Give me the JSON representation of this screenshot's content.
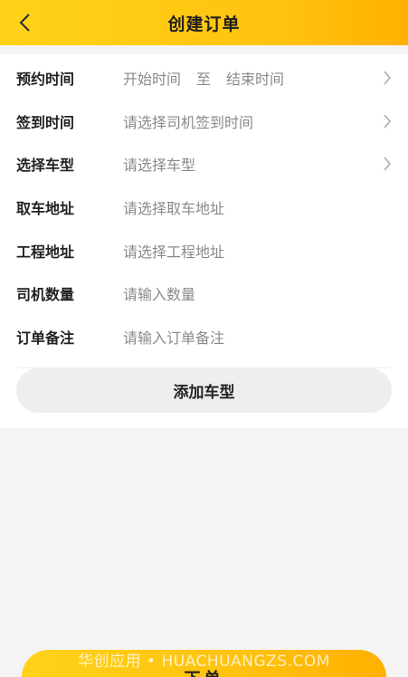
{
  "header": {
    "title": "创建订单",
    "back_icon": "chevron-left-icon"
  },
  "form": {
    "rows": [
      {
        "label": "预约时间",
        "start_placeholder": "开始时间",
        "separator": "至",
        "end_placeholder": "结束时间",
        "has_chevron": true
      },
      {
        "label": "签到时间",
        "placeholder": "请选择司机签到时间",
        "has_chevron": true
      },
      {
        "label": "选择车型",
        "placeholder": "请选择车型",
        "has_chevron": true
      },
      {
        "label": "取车地址",
        "placeholder": "请选择取车地址",
        "has_chevron": false
      },
      {
        "label": "工程地址",
        "placeholder": "请选择工程地址",
        "has_chevron": false
      },
      {
        "label": "司机数量",
        "placeholder": "请输入数量",
        "has_chevron": false
      },
      {
        "label": "订单备注",
        "placeholder": "请输入订单备注",
        "has_chevron": false
      }
    ],
    "add_button_label": "添加车型"
  },
  "footer": {
    "submit_label": "下单",
    "watermark": "华创应用 • HUACHUANGZS.COM"
  },
  "colors": {
    "accent": "#ffc20e",
    "label": "#222222",
    "placeholder": "#8a8a8a",
    "background": "#f4f4f4"
  }
}
